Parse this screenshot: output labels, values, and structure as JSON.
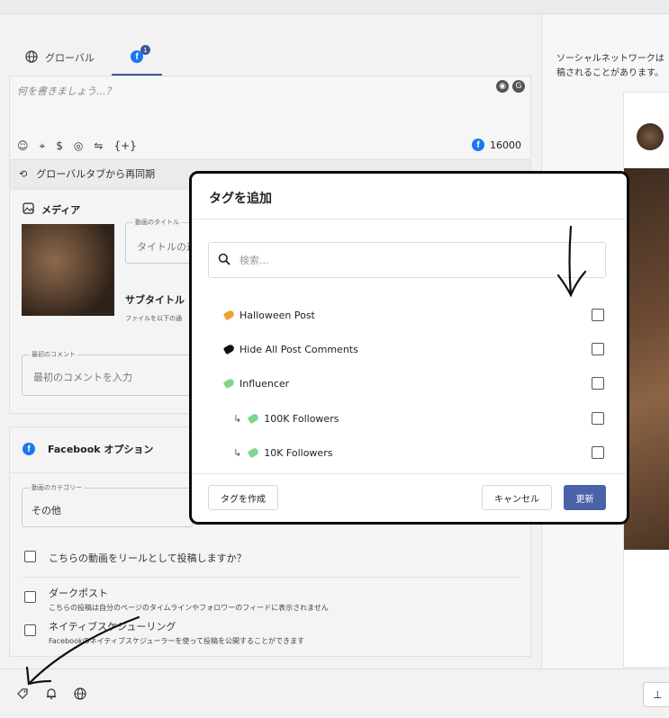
{
  "tabs": {
    "global_label": "グローバル",
    "fb_badge": "1",
    "fb_glyph": "f"
  },
  "editor": {
    "placeholder": "何を書きましょう...？",
    "char_count": "16000",
    "icons": [
      "emoji-icon",
      "location-icon",
      "dollar-icon",
      "podcast-icon",
      "handshake-icon",
      "variable-icon"
    ]
  },
  "resync": {
    "label": "グローバルタブから再同期"
  },
  "media": {
    "title": "メディア",
    "video_title_label": "動画のタイトル",
    "video_title_placeholder": "タイトルの追加",
    "subtitle_label": "サブタイトル",
    "subtitle_hint": "ファイルを以下の通",
    "first_comment_label": "最初のコメント",
    "first_comment_placeholder": "最初のコメントを入力"
  },
  "fb_options": {
    "title": "Facebook オプション",
    "category_label": "動画のカテゴリー",
    "category_value": "その他",
    "reel_label": "こちらの動画をリールとして投稿しますか？",
    "dark_post_label": "ダークポスト",
    "dark_post_desc": "こちらの投稿は自分のページのタイムラインやフォロワーのフィードに表示されません",
    "native_label": "ネイティブスケジューリング",
    "native_desc": "Facebookのネイティブスケジューラーを使って投稿を公開することができます"
  },
  "right_panel": {
    "line1": "ソーシャルネットワークは",
    "line2": "稿されることがあります。"
  },
  "modal": {
    "title": "タグを追加",
    "search_placeholder": "検索...",
    "tags": [
      {
        "name": "Halloween Post",
        "color": "#f0a030",
        "child": false
      },
      {
        "name": "Hide All Post Comments",
        "color": "#111111",
        "child": false
      },
      {
        "name": "Influencer",
        "color": "#7fd68a",
        "child": false
      },
      {
        "name": "100K Followers",
        "color": "#7fd68a",
        "child": true
      },
      {
        "name": "10K Followers",
        "color": "#7fd68a",
        "child": true
      }
    ],
    "create_button": "タグを作成",
    "cancel_button": "キャンセル",
    "update_button": "更新"
  },
  "colors": {
    "accent": "#4a62a8",
    "facebook": "#1877f2"
  }
}
